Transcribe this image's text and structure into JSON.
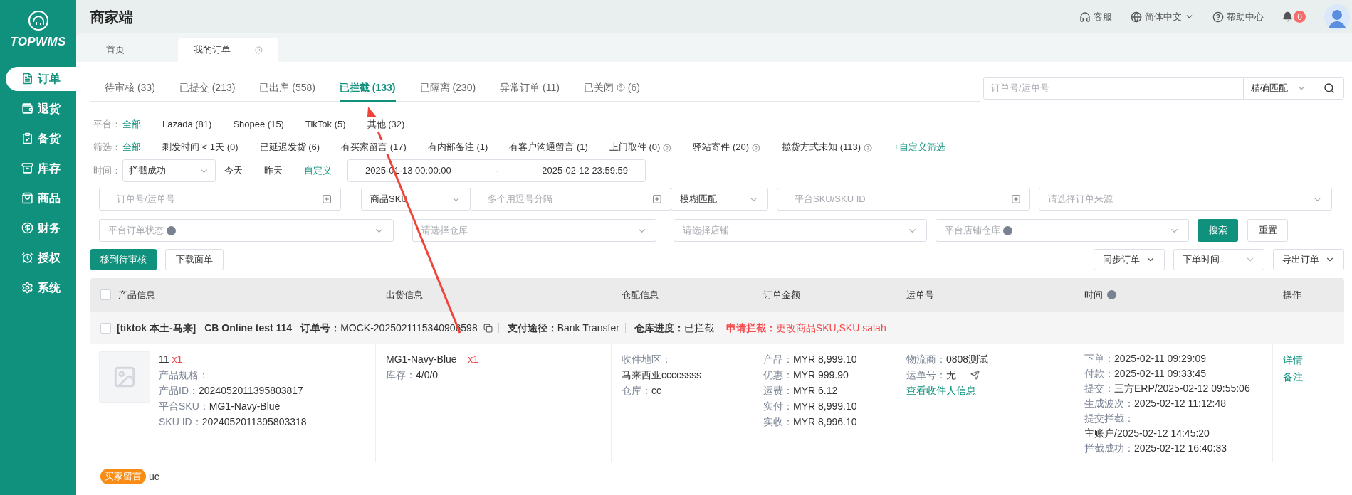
{
  "sidebar": {
    "logo_text": "TOPWMS",
    "items": [
      {
        "kind": "orders",
        "label": "订单",
        "selected": true
      },
      {
        "kind": "returns",
        "label": "退货",
        "selected": false
      },
      {
        "kind": "stocking",
        "label": "备货",
        "selected": false
      },
      {
        "kind": "inventory",
        "label": "库存",
        "selected": false
      },
      {
        "kind": "products",
        "label": "商品",
        "selected": false
      },
      {
        "kind": "finance",
        "label": "财务",
        "selected": false
      },
      {
        "kind": "auth",
        "label": "授权",
        "selected": false
      },
      {
        "kind": "system",
        "label": "系统",
        "selected": false
      }
    ]
  },
  "header": {
    "title": "商家端",
    "actions": [
      {
        "kind": "support",
        "label": "客服",
        "dropdown": false
      },
      {
        "kind": "language",
        "label": "简体中文",
        "dropdown": true
      },
      {
        "kind": "help",
        "label": "帮助中心",
        "dropdown": false
      }
    ],
    "notification_count": "0"
  },
  "page_tabs": [
    {
      "label": "首页",
      "selected": false,
      "closable": false
    },
    {
      "label": "我的订单",
      "selected": true,
      "closable": true
    }
  ],
  "status_tabs": [
    {
      "label": "待审核",
      "count": "(33)",
      "selected": false,
      "help": false
    },
    {
      "label": "已提交",
      "count": "(213)",
      "selected": false,
      "help": false
    },
    {
      "label": "已出库",
      "count": "(558)",
      "selected": false,
      "help": false
    },
    {
      "label": "已拦截",
      "count": "(133)",
      "selected": true,
      "help": false
    },
    {
      "label": "已隔离",
      "count": "(230)",
      "selected": false,
      "help": false
    },
    {
      "label": "异常订单",
      "count": "(11)",
      "selected": false,
      "help": false
    },
    {
      "label": "已关闭",
      "count": "(6)",
      "selected": false,
      "help": true
    }
  ],
  "order_search": {
    "placeholder": "订单号/运单号",
    "match_mode": "精确匹配"
  },
  "platform_filter": {
    "label": "平台：",
    "options": [
      {
        "label": "全部",
        "selected": true
      },
      {
        "label": "Lazada (81)",
        "selected": false
      },
      {
        "label": "Shopee (15)",
        "selected": false
      },
      {
        "label": "TikTok (5)",
        "selected": false
      },
      {
        "label": "其他 (32)",
        "selected": false
      }
    ]
  },
  "quick_filter": {
    "label": "筛选：",
    "options": [
      {
        "label": "全部",
        "selected": true,
        "help": false
      },
      {
        "label": "剩发时间 < 1天 (0)",
        "selected": false,
        "help": false
      },
      {
        "label": "已延迟发货 (6)",
        "selected": false,
        "help": false
      },
      {
        "label": "有买家留言 (17)",
        "selected": false,
        "help": false
      },
      {
        "label": "有内部备注 (1)",
        "selected": false,
        "help": false
      },
      {
        "label": "有客户沟通留言 (1)",
        "selected": false,
        "help": false
      },
      {
        "label": "上门取件 (0)",
        "selected": false,
        "help": true
      },
      {
        "label": "驿站寄件 (20)",
        "selected": false,
        "help": true
      },
      {
        "label": "揽货方式未知 (113)",
        "selected": false,
        "help": true
      }
    ],
    "custom_link": "+自定义筛选"
  },
  "time_filter": {
    "label": "时间：",
    "type": "拦截成功",
    "options": [
      {
        "label": "今天",
        "selected": false
      },
      {
        "label": "昨天",
        "selected": false
      },
      {
        "label": "自定义",
        "selected": true
      }
    ],
    "start": "2025-01-13 00:00:00",
    "separator": "-",
    "end": "2025-02-12 23:59:59"
  },
  "search_rows": [
    [
      {
        "kind": "input",
        "placeholder": "订单号/运单号",
        "add_icon": true
      },
      {
        "kind": "select",
        "value": "商品SKU"
      },
      {
        "kind": "input",
        "placeholder": "多个用逗号分隔",
        "add_icon": true
      },
      {
        "kind": "select",
        "value": "模糊匹配"
      },
      {
        "kind": "input",
        "placeholder": "平台SKU/SKU ID",
        "add_icon": true
      },
      {
        "kind": "select",
        "placeholder": "请选择订单来源"
      }
    ],
    [
      {
        "kind": "select",
        "placeholder": "平台订单状态",
        "help": true
      },
      {
        "kind": "select",
        "placeholder": "请选择仓库"
      },
      {
        "kind": "select",
        "placeholder": "请选择店铺"
      },
      {
        "kind": "select",
        "placeholder": "平台店铺仓库",
        "help": true
      },
      {
        "kind": "primary",
        "label": "搜索"
      },
      {
        "kind": "plain",
        "label": "重置"
      }
    ]
  ],
  "actions_left": [
    {
      "kind": "primary",
      "label": "移到待审核"
    },
    {
      "kind": "plain",
      "label": "下载面单"
    }
  ],
  "actions_right": [
    {
      "kind": "dropdown",
      "label": "同步订单"
    },
    {
      "kind": "select",
      "label": "下单时间↓"
    },
    {
      "kind": "dropdown",
      "label": "导出订单"
    }
  ],
  "table": {
    "select_all_checked": false,
    "columns": [
      {
        "label": "产品信息",
        "help": false
      },
      {
        "label": "出货信息",
        "help": false
      },
      {
        "label": "仓配信息",
        "help": false
      },
      {
        "label": "订单金额",
        "help": false
      },
      {
        "label": "运单号",
        "help": false
      },
      {
        "label": "时间",
        "help": true
      },
      {
        "label": "操作",
        "help": false
      }
    ],
    "order": {
      "checked": false,
      "shop": "[tiktok 本土-马来]",
      "store": "CB Online test 114",
      "fields": [
        {
          "label": "订单号：",
          "value": "MOCK-2025021115340906598",
          "copy": true
        },
        {
          "label": "支付途径：",
          "value": "Bank Transfer",
          "copy": false
        },
        {
          "label": "仓库进度：",
          "value": "已拦截",
          "copy": false
        }
      ],
      "intercept": {
        "label": "申请拦截：",
        "value": "更改商品SKU,SKU salah"
      },
      "product": {
        "name": "11",
        "qty": "x1",
        "lines": [
          {
            "label": "产品规格："
          },
          {
            "label": "产品ID：",
            "value": "2024052011395803817"
          },
          {
            "label": "平台SKU：",
            "value": "MG1-Navy-Blue"
          },
          {
            "label": "SKU ID：",
            "value": "2024052011395803318"
          }
        ]
      },
      "shipping": {
        "sku": "MG1-Navy-Blue",
        "qty": "x1",
        "stock_label": "库存：",
        "stock": "4/0/0"
      },
      "warehouse": {
        "region_label": "收件地区：",
        "region": "马来西亚ccccssss",
        "warehouse_label": "仓库：",
        "warehouse": "cc"
      },
      "amounts": [
        {
          "label": "产品：",
          "value": "MYR 8,999.10"
        },
        {
          "label": "优惠：",
          "value": "MYR 999.90"
        },
        {
          "label": "运费：",
          "value": "MYR 6.12"
        },
        {
          "label": "实付：",
          "value": "MYR 8,999.10"
        },
        {
          "label": "实收：",
          "value": "MYR 8,996.10"
        }
      ],
      "waybill": {
        "carrier_label": "物流商：",
        "carrier": "0808测试",
        "number_label": "运单号：",
        "number": "无",
        "link": "查看收件人信息"
      },
      "times": [
        {
          "label": "下单：",
          "value": "2025-02-11 09:29:09",
          "kind": "inline"
        },
        {
          "label": "付款：",
          "value": "2025-02-11 09:33:45",
          "kind": "inline"
        },
        {
          "label": "提交：",
          "value": "三方ERP/2025-02-12 09:55:06",
          "kind": "inline"
        },
        {
          "label": "生成波次：",
          "value": "2025-02-12 11:12:48",
          "kind": "inline"
        },
        {
          "label": "提交拦截：",
          "value": "主账户/2025-02-12 14:45:20",
          "kind": "stacked"
        },
        {
          "label": "拦截成功：",
          "value": "2025-02-12 16:40:33",
          "kind": "inline"
        }
      ],
      "operations": [
        "详情",
        "备注"
      ],
      "buyer_message": {
        "tag": "买家留言",
        "text": "uc"
      }
    }
  }
}
